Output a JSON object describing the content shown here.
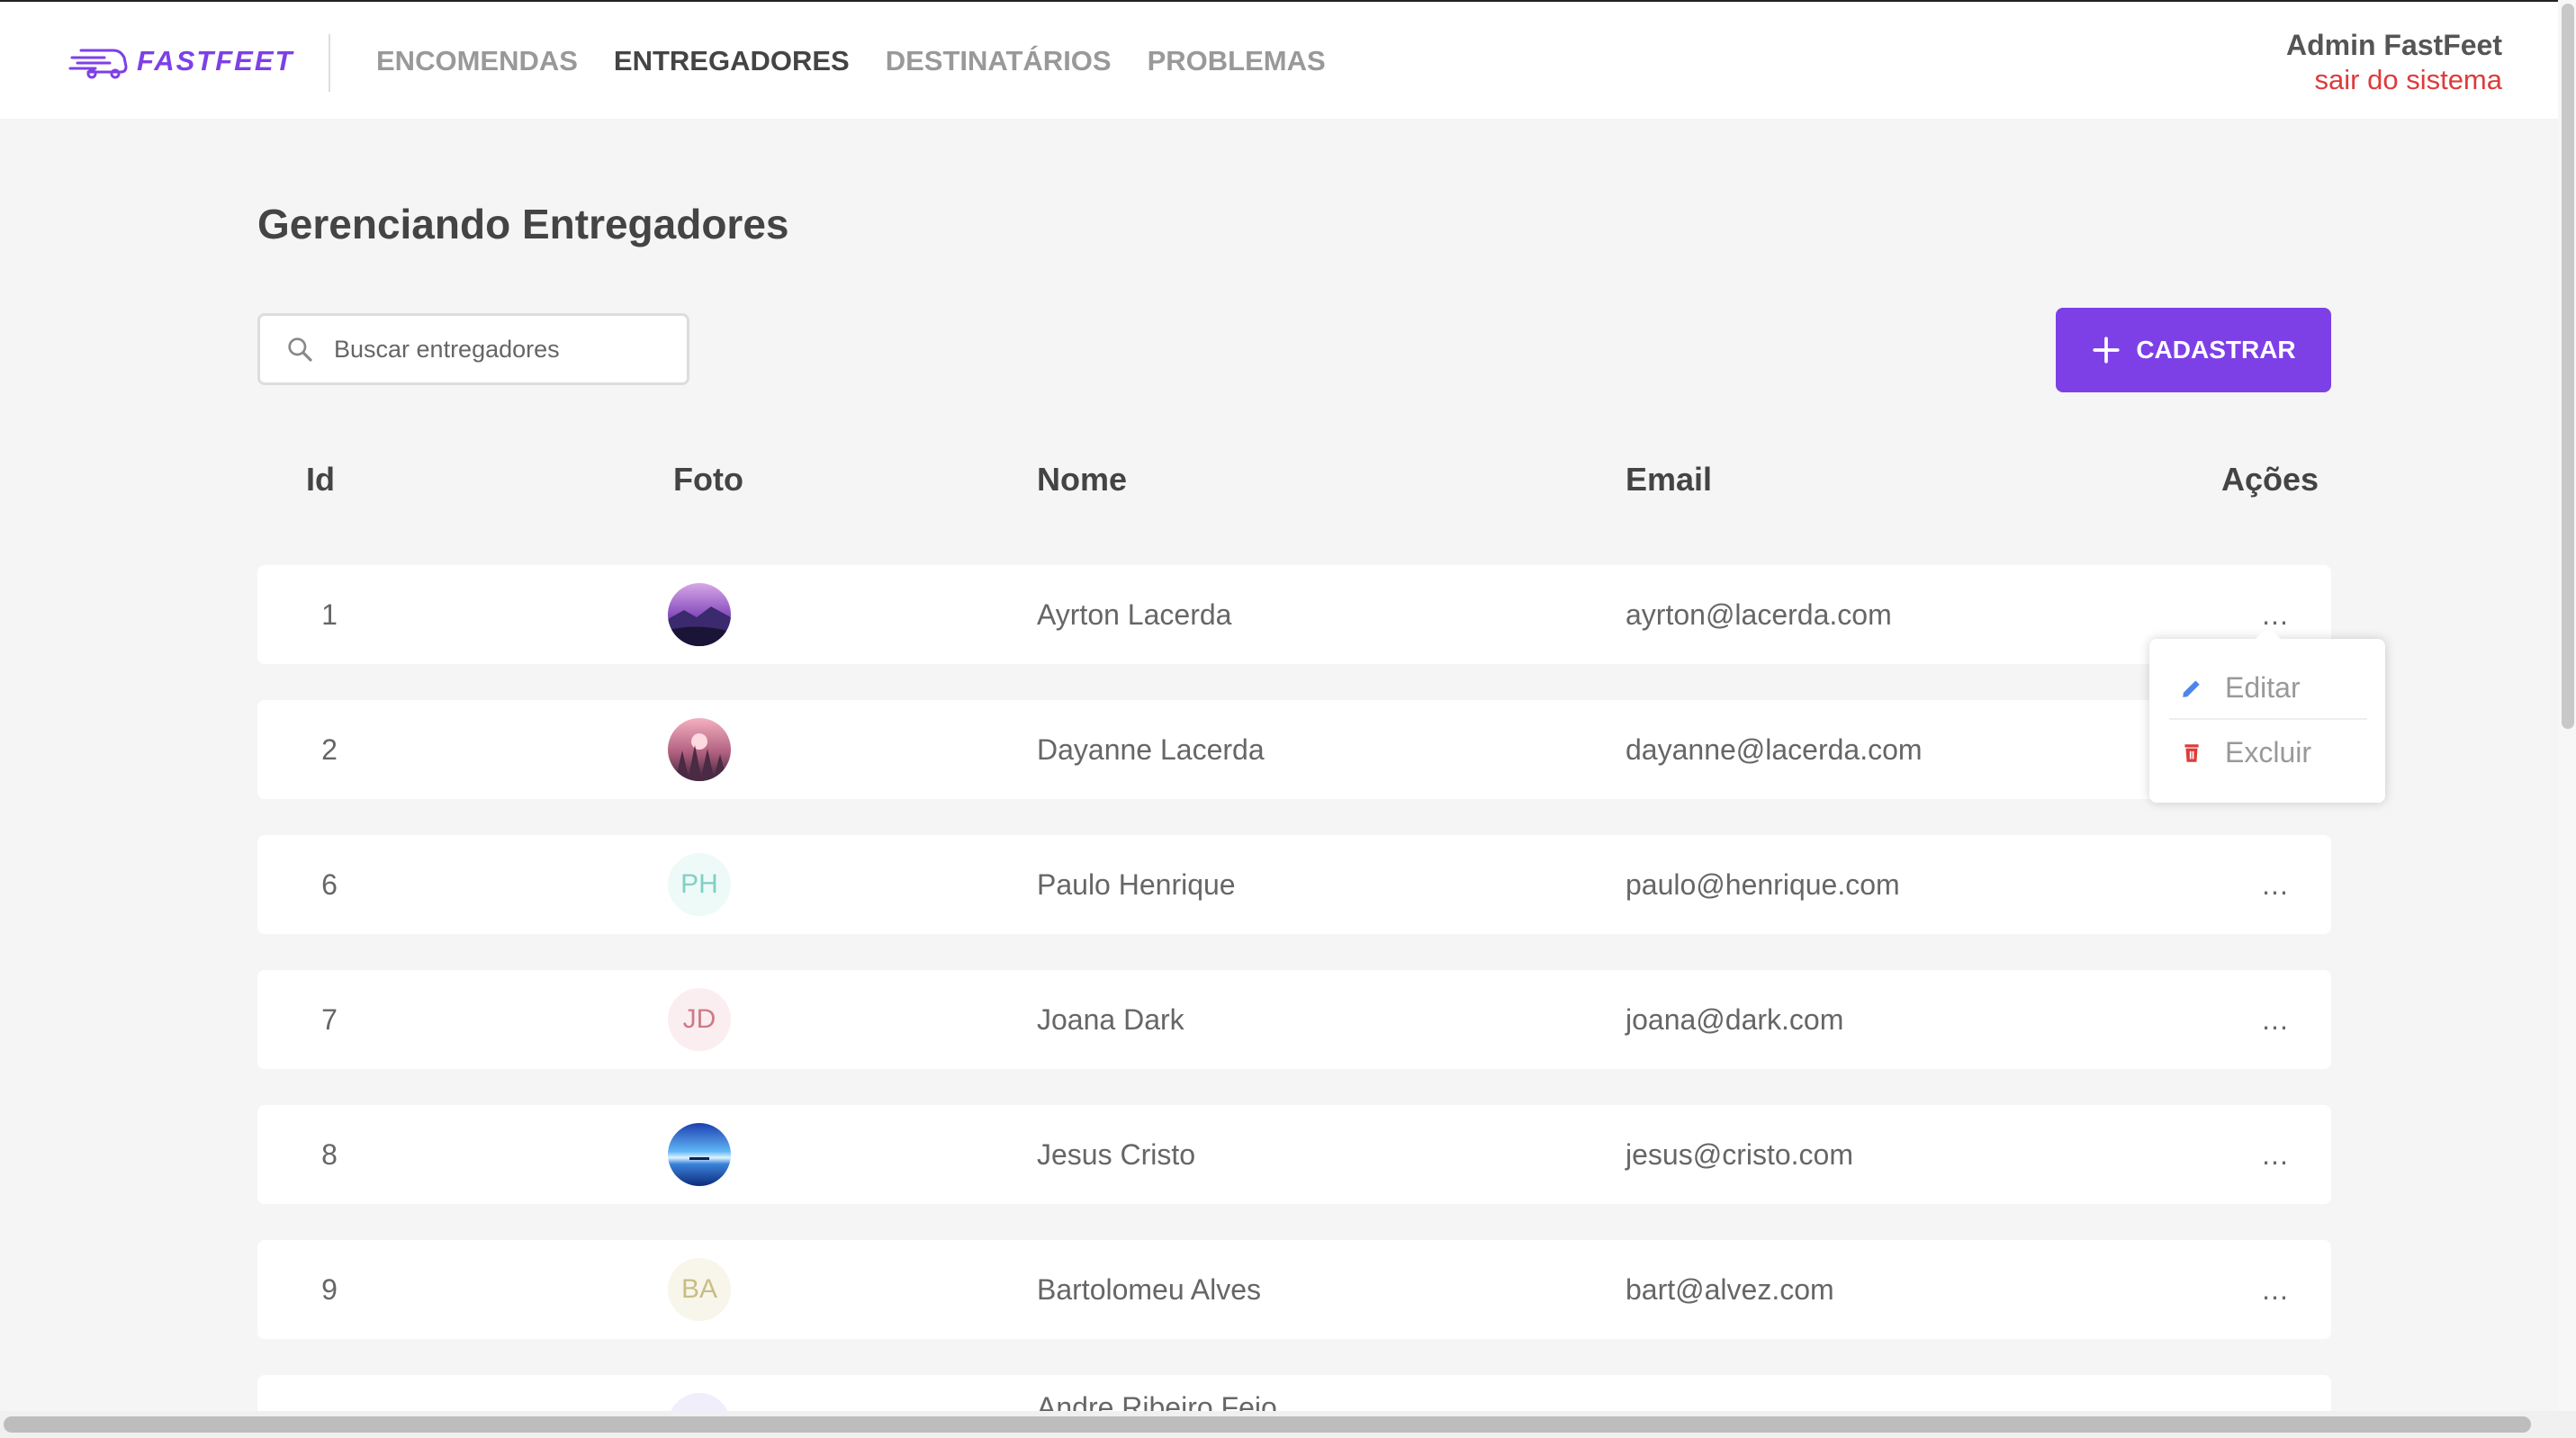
{
  "header": {
    "logo_text": "FASTFEET",
    "nav": [
      {
        "label": "ENCOMENDAS",
        "active": false
      },
      {
        "label": "ENTREGADORES",
        "active": true
      },
      {
        "label": "DESTINATÁRIOS",
        "active": false
      },
      {
        "label": "PROBLEMAS",
        "active": false
      }
    ],
    "user_name": "Admin FastFeet",
    "logout_label": "sair do sistema"
  },
  "page": {
    "title": "Gerenciando Entregadores",
    "search_placeholder": "Buscar entregadores",
    "add_button_label": "CADASTRAR"
  },
  "table": {
    "columns": {
      "id": "Id",
      "photo": "Foto",
      "name": "Nome",
      "email": "Email",
      "actions": "Ações"
    },
    "rows": [
      {
        "id": "1",
        "name": "Ayrton Lacerda",
        "email": "ayrton@lacerda.com",
        "actions": "...",
        "avatar_type": "image",
        "avatar_theme": "purple-lake"
      },
      {
        "id": "2",
        "name": "Dayanne Lacerda",
        "email": "dayanne@lacerda.com",
        "actions": "...",
        "avatar_type": "image",
        "avatar_theme": "pink-forest"
      },
      {
        "id": "6",
        "name": "Paulo Henrique",
        "email": "paulo@henrique.com",
        "actions": "...",
        "avatar_type": "initials",
        "initials": "PH",
        "initials_color": "#82cfc5",
        "initials_bg": "#eefaf8"
      },
      {
        "id": "7",
        "name": "Joana Dark",
        "email": "joana@dark.com",
        "actions": "...",
        "avatar_type": "initials",
        "initials": "JD",
        "initials_color": "#cf7a86",
        "initials_bg": "#fbeef0"
      },
      {
        "id": "8",
        "name": "Jesus Cristo",
        "email": "jesus@cristo.com",
        "actions": "...",
        "avatar_type": "image",
        "avatar_theme": "blue-sea"
      },
      {
        "id": "9",
        "name": "Bartolomeu Alves",
        "email": "bart@alvez.com",
        "actions": "...",
        "avatar_type": "initials",
        "initials": "BA",
        "initials_color": "#c9bd86",
        "initials_bg": "#f8f6ea"
      },
      {
        "id": "",
        "name": "Andre Ribeiro Feio",
        "email": "",
        "actions": "",
        "avatar_type": "initials",
        "initials": "",
        "initials_color": "#a99ed8",
        "initials_bg": "#f1eefb"
      }
    ]
  },
  "dropdown": {
    "edit_label": "Editar",
    "delete_label": "Excluir"
  },
  "colors": {
    "brand": "#7d40e7",
    "logout": "#de3b3b",
    "edit_icon": "#4d85ee",
    "delete_icon": "#de3b3b"
  }
}
